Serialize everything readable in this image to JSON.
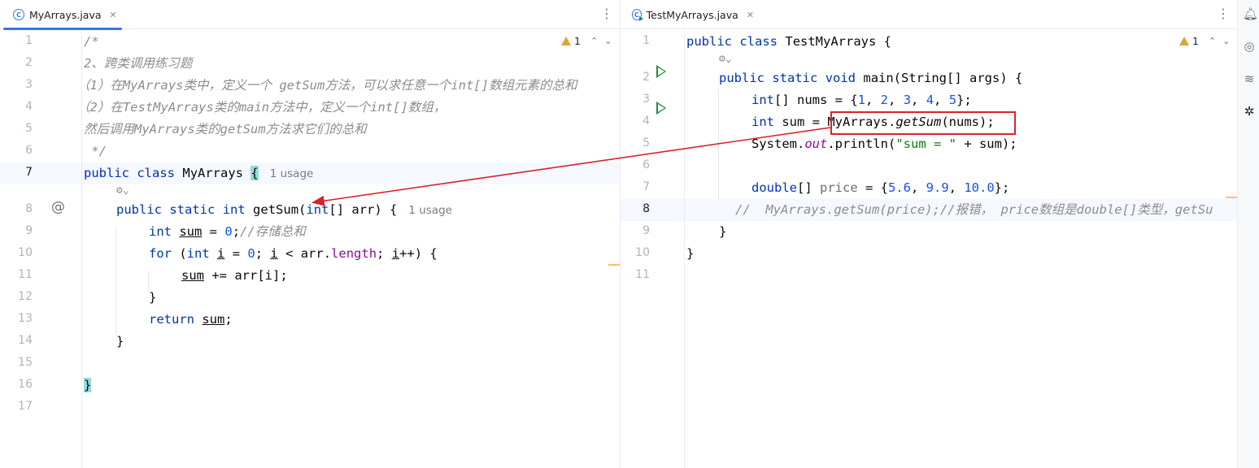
{
  "colors": {
    "accent": "#3574f0",
    "keyword": "#0033b3",
    "number": "#1750eb",
    "string": "#067d17",
    "comment": "#8c8c8c",
    "field": "#871094",
    "warning": "#e1a336",
    "run": "#208a3c",
    "annotation_red": "#d9232a"
  },
  "left_editor": {
    "tab": {
      "label": "MyArrays.java",
      "icon": "class-file-icon",
      "close_icon": "close-icon"
    },
    "warnings": {
      "count": "1"
    },
    "line_numbers": [
      "1",
      "2",
      "3",
      "4",
      "5",
      "6",
      "7",
      "8",
      "9",
      "10",
      "11",
      "12",
      "13",
      "14",
      "15",
      "16",
      "17"
    ],
    "current_line": "7",
    "gutter_marker": "@",
    "lines": {
      "l1": "/*",
      "l2": "2、跨类调用练习题",
      "l3": "（1）在MyArrays类中，定义一个 getSum方法，可以求任意一个int[]数组元素的总和",
      "l4": "（2）在TestMyArrays类的main方法中，定义一个int[]数组，",
      "l5": "然后调用MyArrays类的getSum方法求它们的总和",
      "l6": " */",
      "l7": {
        "kw1": "public",
        "kw2": "class",
        "name": "MyArrays",
        "brace": "{",
        "hint": "1 usage"
      },
      "l8": {
        "kw1": "public",
        "kw2": "static",
        "kw3": "int",
        "name": "getSum",
        "open": "(",
        "ptype": "int",
        "rest": "[] arr) {",
        "hint": "1 usage"
      },
      "l9": {
        "type": "int",
        "var": "sum",
        "op": " = ",
        "num": "0",
        "semi": ";",
        "comment": "//存储总和"
      },
      "l10": {
        "kw": "for",
        "p1": " (",
        "type": "int",
        "var": "i",
        "op": " = ",
        "num": "0",
        "semi": "; ",
        "var2": "i",
        "lt": " < arr.",
        "field": "length",
        "semi2": "; ",
        "var3": "i",
        "inc": "++) {"
      },
      "l11": {
        "var": "sum",
        "rest": " += arr[i];"
      },
      "l12": "}",
      "l13": {
        "kw": "return",
        "var": "sum",
        "semi": ";"
      },
      "l14": "}",
      "l16": "}"
    }
  },
  "right_editor": {
    "tab": {
      "label": "TestMyArrays.java",
      "icon": "runnable-class-file-icon",
      "close_icon": "close-icon"
    },
    "warnings": {
      "count": "1"
    },
    "line_numbers": [
      "1",
      "2",
      "3",
      "4",
      "5",
      "6",
      "7",
      "8",
      "9",
      "10",
      "11"
    ],
    "current_line": "8",
    "lines": {
      "l1": {
        "kw1": "public",
        "kw2": "class",
        "name": "TestMyArrays {"
      },
      "l2": {
        "kw1": "public",
        "kw2": "static",
        "kw3": "void",
        "name": "main(String[] args) {"
      },
      "l3": {
        "type": "int",
        "mid": "[] nums = {",
        "n1": "1",
        "n2": "2",
        "n3": "3",
        "n4": "4",
        "n5": "5",
        "end": "};",
        "sep": ", "
      },
      "l4": {
        "type": "int",
        "mid": " sum = ",
        "cls": "MyArrays.",
        "method": "getSum",
        "end": "(nums);"
      },
      "l5": {
        "cls": "System.",
        "field": "out",
        "mid": ".println(",
        "str": "\"sum = \"",
        "end": " + sum);"
      },
      "l7": {
        "type": "double",
        "mid": "[] ",
        "var": "price",
        "eq": " = {",
        "n1": "5.6",
        "n2": "9.9",
        "n3": "10.0",
        "end": "};",
        "sep": ", "
      },
      "l8": "//  MyArrays.getSum(price);//报错， price数组是double[]类型，getSu",
      "l9": "}",
      "l10": "}"
    }
  }
}
